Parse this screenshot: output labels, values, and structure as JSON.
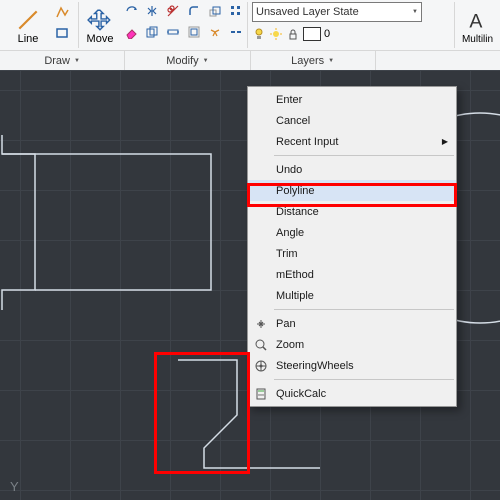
{
  "ribbon": {
    "line_label": "Line",
    "move_label": "Move",
    "multiline_label": "Multilin",
    "layer_state": "Unsaved Layer State",
    "layer_current": "0",
    "panels": {
      "draw": "Draw",
      "modify": "Modify",
      "layers": "Layers"
    }
  },
  "menu": {
    "enter": "Enter",
    "cancel": "Cancel",
    "recent": "Recent Input",
    "undo": "Undo",
    "polyline": "Polyline",
    "distance": "Distance",
    "angle": "Angle",
    "trim": "Trim",
    "method": "mEthod",
    "multiple": "Multiple",
    "pan": "Pan",
    "zoom": "Zoom",
    "steering": "SteeringWheels",
    "quickcalc": "QuickCalc"
  },
  "ucs": {
    "y": "Y"
  },
  "icons": {
    "line": "line-icon",
    "move": "move-icon",
    "polyline": "polyline-icon",
    "circle": "circle-icon",
    "arc": "arc-icon",
    "rect": "rect-icon",
    "mirror": "mirror-icon",
    "fillet": "fillet-icon",
    "trim": "trim-icon",
    "copy": "copy-icon",
    "stretch": "stretch-icon",
    "array": "array-icon",
    "rotate": "rotate-icon",
    "scale": "scale-icon",
    "erase": "erase-icon",
    "bulb_on": "layer-on-icon",
    "sun": "thaw-icon",
    "lock": "lock-icon",
    "pan": "pan-icon",
    "zoom": "zoom-icon",
    "wheel": "steering-wheel-icon",
    "calc": "calculator-icon"
  },
  "colors": {
    "drawing": "#d5dde6",
    "grid_bg": "#33373d",
    "accent": "#ff0000"
  }
}
